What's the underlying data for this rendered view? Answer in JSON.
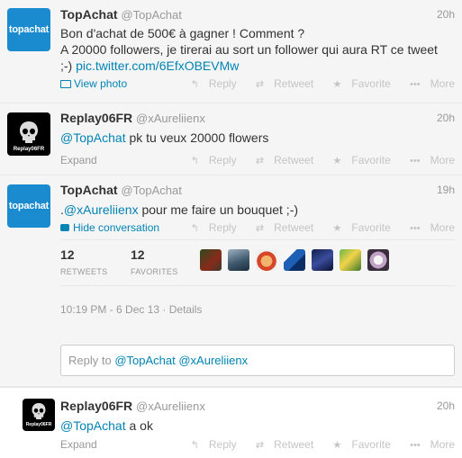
{
  "tweets": [
    {
      "name": "TopAchat",
      "handle": "@TopAchat",
      "time": "20h",
      "avatar_text": "topachat",
      "text_line1": "Bon d'achat de 500€ à gagner ! Comment ?",
      "text_line2": "A 20000 followers, je tirerai au sort un follower qui aura RT ce tweet",
      "text_line3": ";-)",
      "link": "pic.twitter.com/6EfxOBEVMw",
      "action_meta": "View photo"
    },
    {
      "name": "Replay06FR",
      "handle": "@xAureliienx",
      "time": "20h",
      "avatar_text": "Replay06FR",
      "mention": "@TopAchat",
      "text": "pk tu veux 20000 flowers",
      "action_meta": "Expand"
    },
    {
      "name": "TopAchat",
      "handle": "@TopAchat",
      "time": "19h",
      "avatar_text": "topachat",
      "prefix": ".",
      "mention": "@xAureliienx",
      "text": "pour me faire un bouquet ;-)",
      "action_meta": "Hide conversation",
      "retweets_count": "12",
      "retweets_label": "RETWEETS",
      "favorites_count": "12",
      "favorites_label": "FAVORITES",
      "timestamp": "10:19 PM - 6 Dec 13",
      "details": "Details"
    },
    {
      "name": "Replay06FR",
      "handle": "@xAureliienx",
      "time": "20h",
      "avatar_text": "Replay06FR",
      "mention": "@TopAchat",
      "text": "a ok",
      "action_meta": "Expand"
    }
  ],
  "actions": {
    "reply": "Reply",
    "retweet": "Retweet",
    "favorite": "Favorite",
    "more": "More"
  },
  "reply_box": {
    "prefix": "Reply to",
    "mention1": "@TopAchat",
    "mention2": "@xAureliienx"
  },
  "colors": {
    "link": "#0084b4",
    "topachat_brand": "#1b8bd0"
  }
}
